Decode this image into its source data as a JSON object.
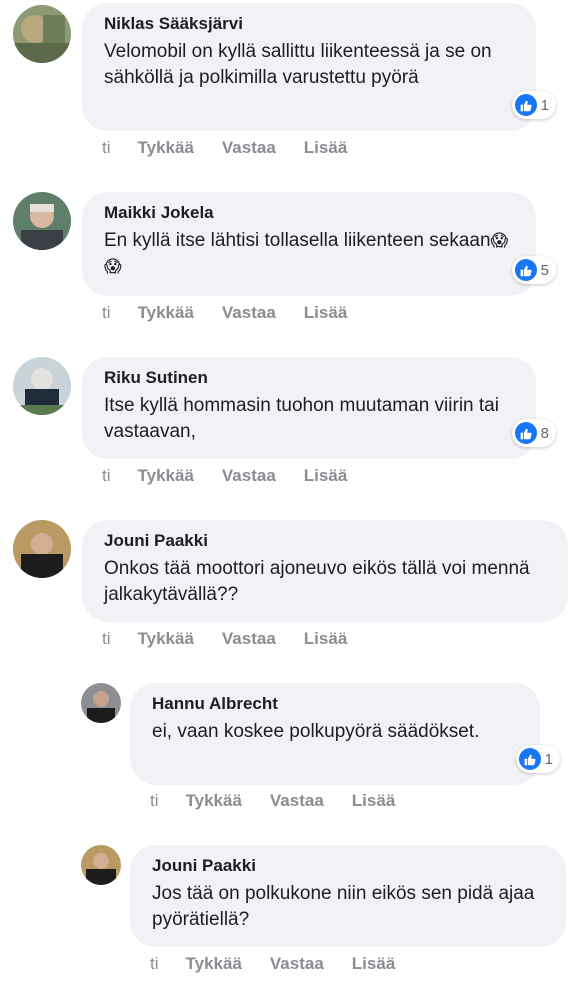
{
  "comments": [
    {
      "author": "Niklas Sääksjärvi",
      "text": "Velomobil on kyllä sallittu liikenteessä ja se on sähköllä ja polkimilla varustettu pyörä",
      "emoji": "",
      "reactions": "1",
      "time": "ti",
      "like": "Tykkää",
      "reply": "Vastaa",
      "more": "Lisää"
    },
    {
      "author": "Maikki Jokela",
      "text": "En kyllä itse lähtisi tollasella liikenteen sekaan",
      "emoji": "😱😱",
      "reactions": "5",
      "time": "ti",
      "like": "Tykkää",
      "reply": "Vastaa",
      "more": "Lisää"
    },
    {
      "author": "Riku Sutinen",
      "text": "Itse kyllä hommasin tuohon muutaman viirin tai vastaavan,",
      "emoji": "",
      "reactions": "8",
      "time": "ti",
      "like": "Tykkää",
      "reply": "Vastaa",
      "more": "Lisää"
    },
    {
      "author": "Jouni Paakki",
      "text": "Onkos tää moottori ajoneuvo eikös tällä voi mennä jalkakytävällä??",
      "emoji": "",
      "time": "ti",
      "like": "Tykkää",
      "reply": "Vastaa",
      "more": "Lisää"
    },
    {
      "author": "Hannu Albrecht",
      "text": "ei, vaan koskee polkupyörä säädökset.",
      "emoji": "",
      "reactions": "1",
      "time": "ti",
      "like": "Tykkää",
      "reply": "Vastaa",
      "more": "Lisää"
    },
    {
      "author": "Jouni Paakki",
      "text": "Jos tää on polkukone niin eikös sen pidä ajaa pyörätiellä?",
      "emoji": "",
      "time": "ti",
      "like": "Tykkää",
      "reply": "Vastaa",
      "more": "Lisää"
    }
  ],
  "colors": {
    "bubble": "#f0f2f5",
    "text": "#1c1e21",
    "muted": "#8a8d91",
    "like_blue": "#1877f2"
  },
  "icons": {
    "reaction": "thumbs-up-icon"
  }
}
